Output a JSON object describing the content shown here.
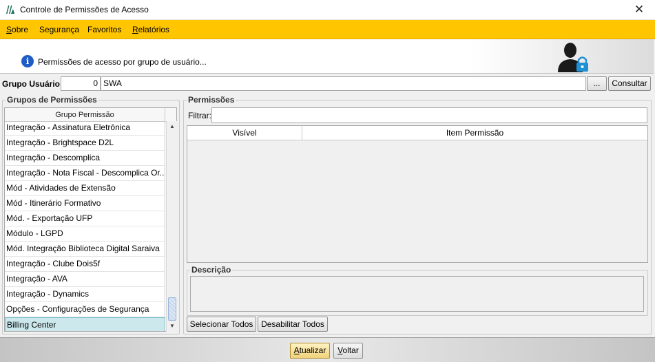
{
  "window": {
    "title": "Controle de Permissões de Acesso",
    "close_glyph": "✕"
  },
  "menu": [
    {
      "label": "Sobre",
      "accel": "S",
      "rest": "obre"
    },
    {
      "label": "Segurança"
    },
    {
      "label": "Favoritos"
    },
    {
      "label": "Relatórios",
      "accel": "R",
      "rest": "elatórios"
    }
  ],
  "banner": {
    "text": "Permissões de acesso por grupo de usuário...",
    "icons": [
      "info-icon",
      "user-lock-icon"
    ]
  },
  "grupo_usuario": {
    "label": "Grupo Usuário:",
    "code": "0",
    "name": "SWA",
    "browse_label": "...",
    "consult_label": "Consultar"
  },
  "grupos": {
    "title": "Grupos de Permissões",
    "column_header": "Grupo Permissão",
    "items": [
      "Integração - Assinatura Eletrônica",
      "Integração - Brightspace D2L",
      "Integração - Descomplica",
      "Integração - Nota Fiscal - Descomplica Or...",
      "Mód - Atividades de Extensão",
      "Mód - Itinerário Formativo",
      "Mód. - Exportação UFP",
      "Módulo - LGPD",
      "Mód. Integração Biblioteca Digital Saraiva",
      "Integração - Clube Dois5f",
      "Integração - AVA",
      "Integração - Dynamics",
      "Opções - Configurações de Segurança",
      "Billing Center"
    ],
    "selected": "Billing Center"
  },
  "permissoes": {
    "title": "Permissões",
    "filter_label": "Filtrar:",
    "filter_value": "",
    "columns": [
      "Visível",
      "Item Permissão"
    ],
    "rows": [],
    "descricao_label": "Descrição",
    "select_all_label": "Selecionar Todos",
    "disable_all_label": "Desabilitar Todos"
  },
  "footer": {
    "update_label": "Atualizar",
    "update_accel": "A",
    "update_rest": "tualizar",
    "back_label": "Voltar",
    "back_accel": "V",
    "back_rest": "oltar"
  },
  "colors": {
    "menubar": "#ffc600",
    "selection": "#cce8ec",
    "info": "#1f5cc7",
    "lock": "#1e90d6"
  }
}
